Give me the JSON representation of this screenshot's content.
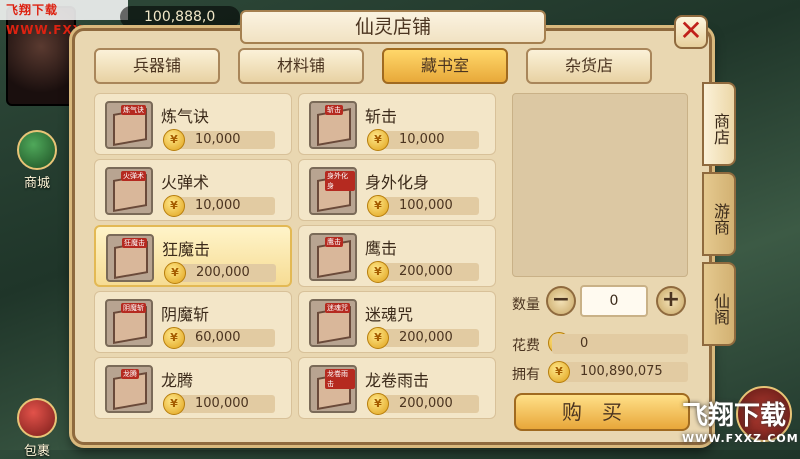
{
  "watermark_top": "飞翔下载 WWW.FXXZ.COM",
  "top_gold": "100,888,0",
  "side_buttons": {
    "mall": "商城",
    "bag": "包裹"
  },
  "dialog": {
    "title": "仙灵店铺",
    "close": "✕",
    "tabs": [
      "兵器铺",
      "材料铺",
      "藏书室",
      "杂货店"
    ],
    "active_tab": "藏书室"
  },
  "items": [
    {
      "name": "炼气诀",
      "tag": "炼气诀",
      "price": "10,000"
    },
    {
      "name": "斩击",
      "tag": "斩击",
      "price": "10,000"
    },
    {
      "name": "火弹术",
      "tag": "火弹术",
      "price": "10,000"
    },
    {
      "name": "身外化身",
      "tag": "身外化身",
      "price": "100,000"
    },
    {
      "name": "狂魔击",
      "tag": "狂魔击",
      "price": "200,000"
    },
    {
      "name": "鹰击",
      "tag": "鹰击",
      "price": "200,000"
    },
    {
      "name": "阴魔斩",
      "tag": "阴魔斩",
      "price": "60,000"
    },
    {
      "name": "迷魂咒",
      "tag": "迷魂咒",
      "price": "200,000"
    },
    {
      "name": "龙腾",
      "tag": "龙腾",
      "price": "100,000"
    },
    {
      "name": "龙卷雨击",
      "tag": "龙卷雨击",
      "price": "200,000"
    }
  ],
  "purchase": {
    "qty_label": "数量",
    "qty_value": "0",
    "cost_label": "花费",
    "cost_value": "0",
    "own_label": "拥有",
    "own_value": "100,890,075",
    "buy_button": "购买",
    "minus": "−",
    "plus": "+"
  },
  "side_tabs": [
    "商店",
    "游商",
    "仙阁"
  ],
  "watermark_br": {
    "main": "飞翔下载",
    "sub": "WWW.FXXZ.COM"
  }
}
